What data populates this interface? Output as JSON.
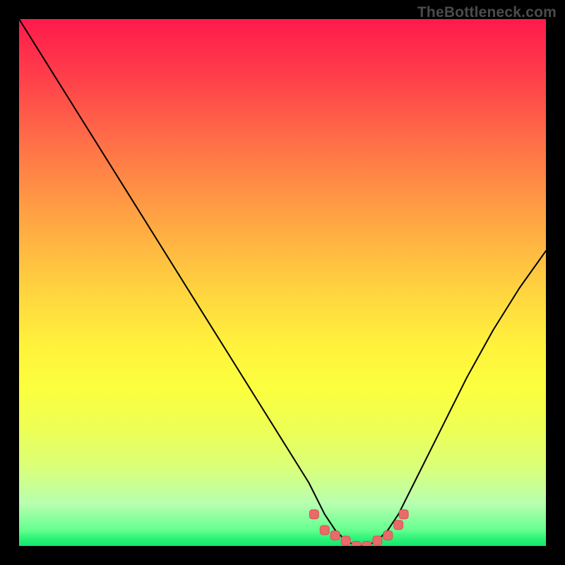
{
  "watermark": "TheBottleneck.com",
  "colors": {
    "frame": "#000000",
    "curve": "#000000",
    "marker": "#e96a6a",
    "marker_stroke": "#d45454",
    "green": "#14e86d",
    "red": "#ff1a4c"
  },
  "chart_data": {
    "type": "line",
    "title": "",
    "xlabel": "",
    "ylabel": "",
    "xlim": [
      0,
      100
    ],
    "ylim": [
      0,
      100
    ],
    "series": [
      {
        "name": "bottleneck-curve",
        "x": [
          0,
          5,
          10,
          15,
          20,
          25,
          30,
          35,
          40,
          45,
          50,
          55,
          58,
          60,
          62,
          64,
          66,
          68,
          70,
          72,
          75,
          80,
          85,
          90,
          95,
          100
        ],
        "y": [
          100,
          92,
          84,
          76,
          68,
          60,
          52,
          44,
          36,
          28,
          20,
          12,
          6,
          3,
          1,
          0,
          0,
          1,
          3,
          6,
          12,
          22,
          32,
          41,
          49,
          56
        ]
      }
    ],
    "markers": {
      "name": "optimal-range-dots",
      "x": [
        56,
        58,
        60,
        62,
        64,
        66,
        68,
        70,
        72,
        73
      ],
      "y": [
        6,
        3,
        2,
        1,
        0,
        0,
        1,
        2,
        4,
        6
      ]
    },
    "annotations": []
  }
}
